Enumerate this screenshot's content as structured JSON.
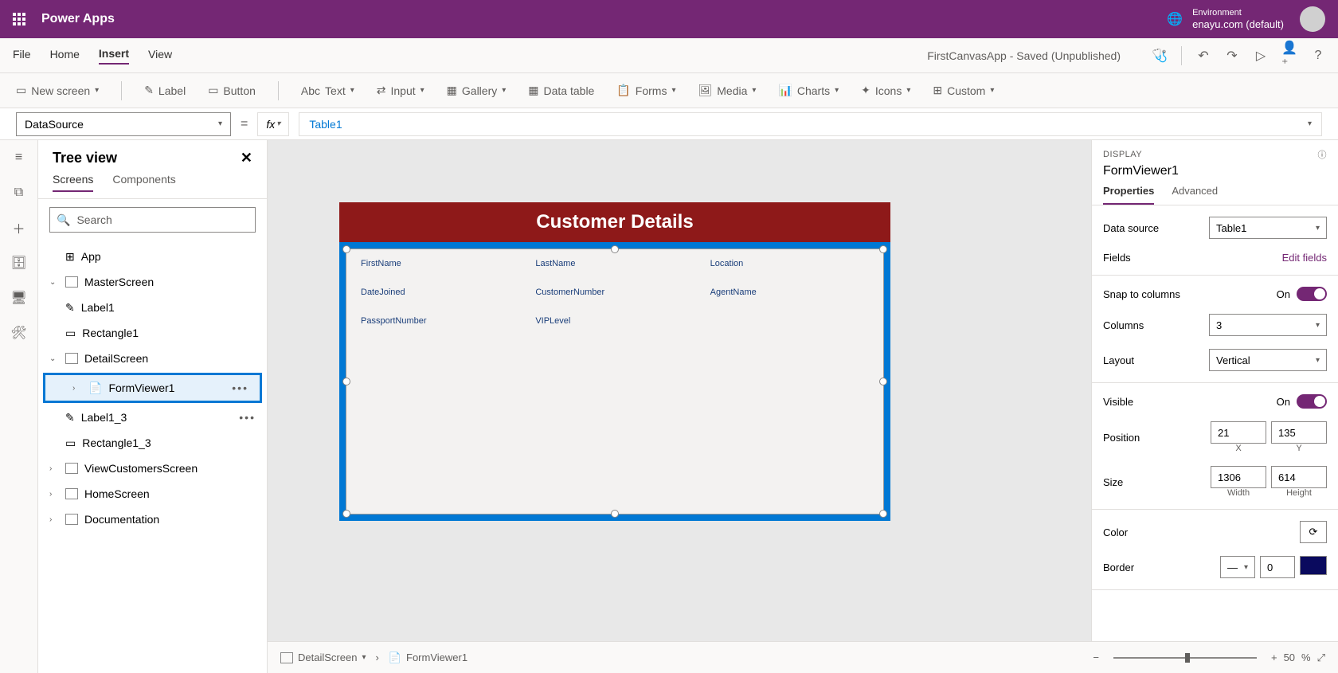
{
  "header": {
    "app_title": "Power Apps",
    "env_label": "Environment",
    "env_name": "enayu.com (default)"
  },
  "menu": {
    "items": [
      "File",
      "Home",
      "Insert",
      "View"
    ],
    "active": "Insert",
    "saved": "FirstCanvasApp - Saved (Unpublished)"
  },
  "ribbon": {
    "new_screen": "New screen",
    "label": "Label",
    "button": "Button",
    "text": "Text",
    "input": "Input",
    "gallery": "Gallery",
    "data_table": "Data table",
    "forms": "Forms",
    "media": "Media",
    "charts": "Charts",
    "icons": "Icons",
    "custom": "Custom"
  },
  "formula": {
    "property": "DataSource",
    "value": "Table1",
    "fx": "fx"
  },
  "tree": {
    "title": "Tree view",
    "tabs": {
      "screens": "Screens",
      "components": "Components"
    },
    "search_placeholder": "Search",
    "items": {
      "app": "App",
      "master": "MasterScreen",
      "label1": "Label1",
      "rect1": "Rectangle1",
      "detail": "DetailScreen",
      "formviewer": "FormViewer1",
      "label13": "Label1_3",
      "rect13": "Rectangle1_3",
      "viewcust": "ViewCustomersScreen",
      "home": "HomeScreen",
      "doc": "Documentation"
    }
  },
  "canvas": {
    "title": "Customer Details",
    "fields": [
      "FirstName",
      "LastName",
      "Location",
      "DateJoined",
      "CustomerNumber",
      "AgentName",
      "PassportNumber",
      "VIPLevel"
    ]
  },
  "props": {
    "section": "DISPLAY",
    "name": "FormViewer1",
    "tabs": {
      "properties": "Properties",
      "advanced": "Advanced"
    },
    "data_source": {
      "label": "Data source",
      "value": "Table1"
    },
    "fields": {
      "label": "Fields",
      "link": "Edit fields"
    },
    "snap": {
      "label": "Snap to columns",
      "value": "On"
    },
    "columns": {
      "label": "Columns",
      "value": "3"
    },
    "layout": {
      "label": "Layout",
      "value": "Vertical"
    },
    "visible": {
      "label": "Visible",
      "value": "On"
    },
    "position": {
      "label": "Position",
      "x": "21",
      "y": "135",
      "xlabel": "X",
      "ylabel": "Y"
    },
    "size": {
      "label": "Size",
      "w": "1306",
      "h": "614",
      "wlabel": "Width",
      "hlabel": "Height"
    },
    "color": {
      "label": "Color"
    },
    "border": {
      "label": "Border",
      "value": "0"
    }
  },
  "bottom": {
    "screen": "DetailScreen",
    "control": "FormViewer1",
    "zoom": "50",
    "pct": "%"
  }
}
